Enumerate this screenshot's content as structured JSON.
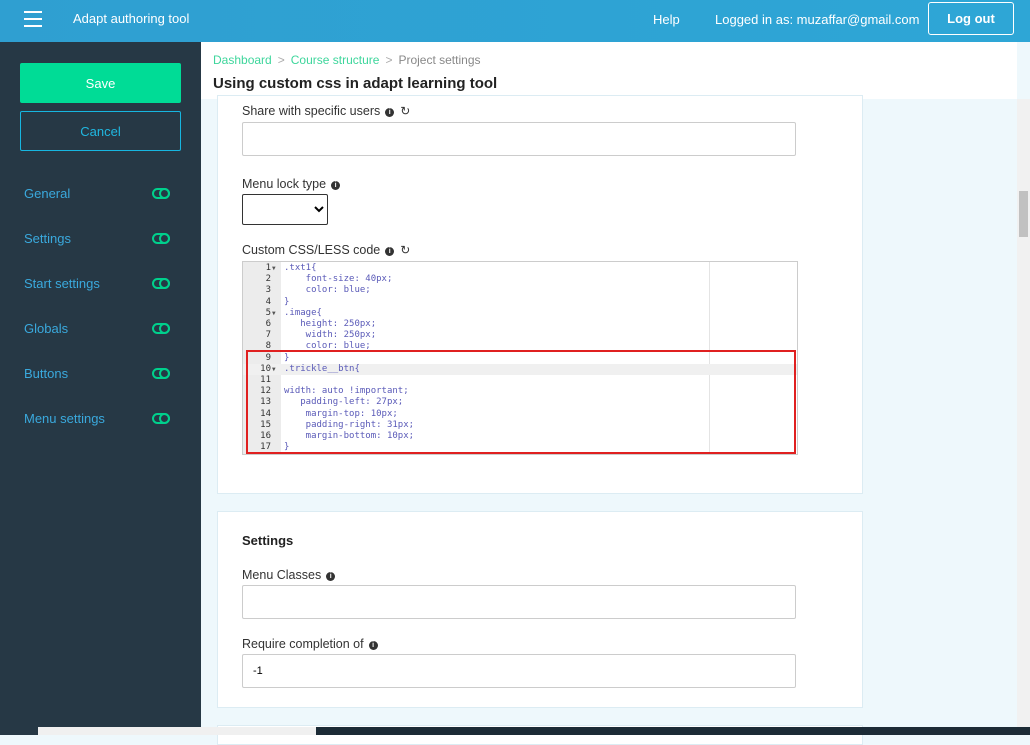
{
  "header": {
    "app_title": "Adapt authoring tool",
    "help": "Help",
    "logged_in": "Logged in as: muzaffar@gmail.com",
    "logout": "Log out"
  },
  "sidebar": {
    "save": "Save",
    "cancel": "Cancel",
    "items": [
      {
        "label": "General"
      },
      {
        "label": "Settings"
      },
      {
        "label": "Start settings"
      },
      {
        "label": "Globals"
      },
      {
        "label": "Buttons"
      },
      {
        "label": "Menu settings"
      }
    ]
  },
  "breadcrumb": {
    "items": [
      "Dashboard",
      "Course structure"
    ],
    "current": "Project settings"
  },
  "page_title": "Using custom css in adapt learning tool",
  "form": {
    "share_label": "Share with specific users",
    "share_value": "",
    "menu_lock_label": "Menu lock type",
    "menu_lock_value": "",
    "css_label": "Custom CSS/LESS code",
    "code_lines": [
      ".txt1{",
      "    font-size: 40px;",
      "    color: blue;",
      "}",
      ".image{",
      "   height: 250px;",
      "    width: 250px;",
      "    color: blue;",
      "}",
      ".trickle__btn{",
      "",
      "width: auto !important;",
      "   padding-left: 27px;",
      "    margin-top: 10px;",
      "    padding-right: 31px;",
      "    margin-bottom: 10px;",
      "}"
    ],
    "fold_lines": [
      1,
      5,
      10
    ],
    "active_line": 10
  },
  "settings": {
    "title": "Settings",
    "menu_classes_label": "Menu Classes",
    "menu_classes_value": "",
    "require_label": "Require completion of",
    "require_value": "-1"
  },
  "colors": {
    "header": "#2f9fd1",
    "sidebar": "#263845",
    "accent": "#00dc96",
    "highlight_box": "#e02020"
  }
}
